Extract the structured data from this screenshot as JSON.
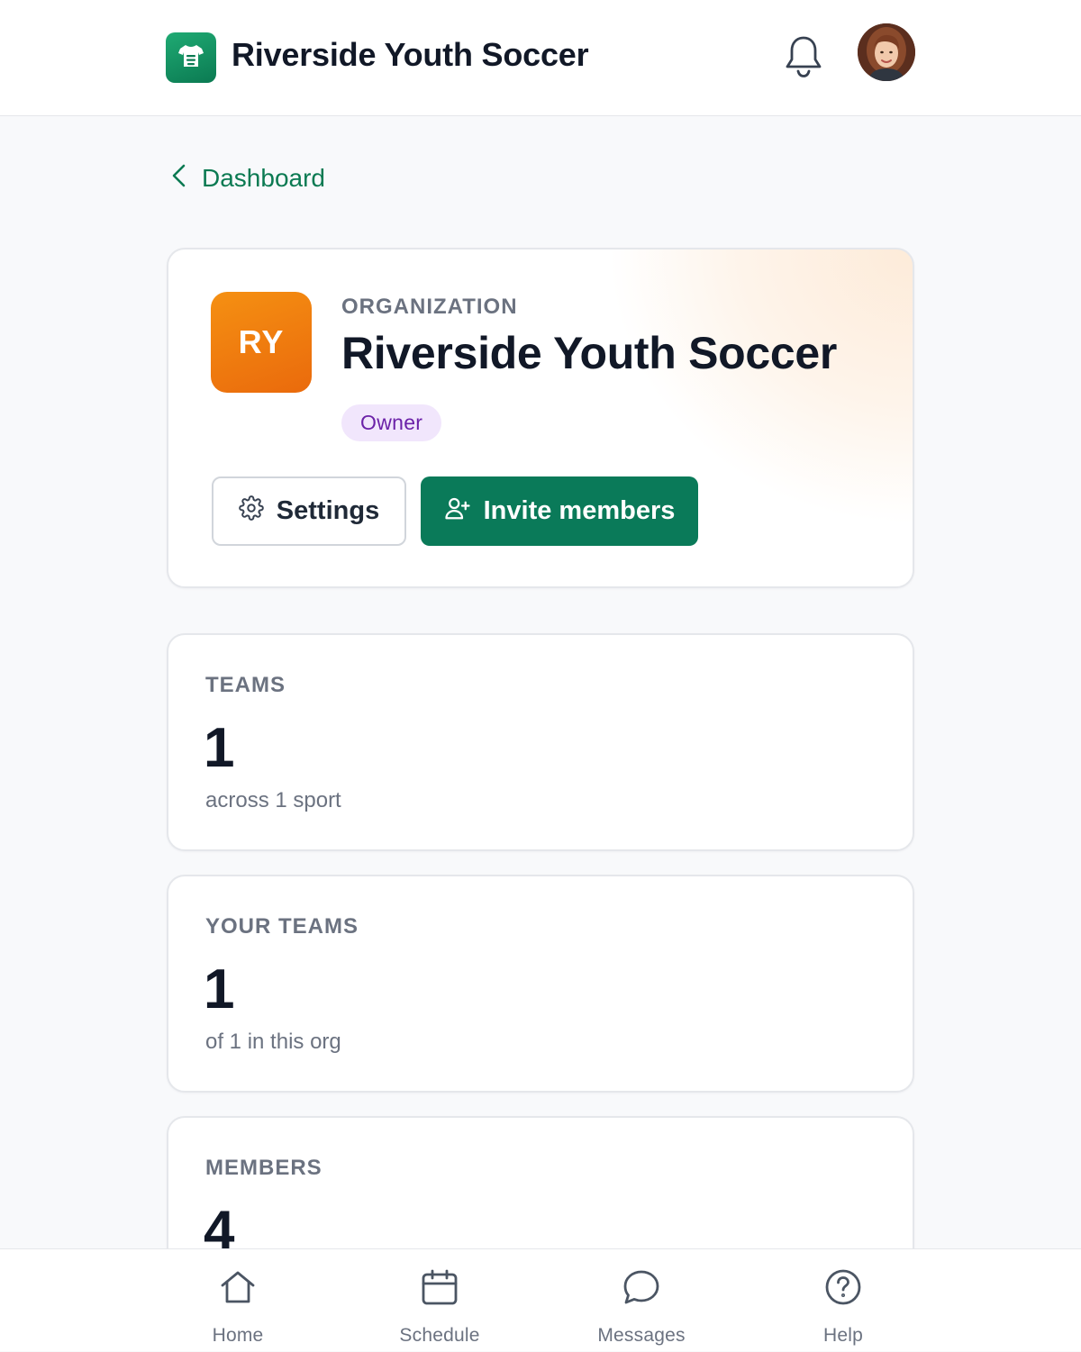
{
  "header": {
    "app_title": "Riverside Youth Soccer",
    "logo_icon": "jersey-icon",
    "notifications_icon": "bell-icon",
    "avatar_icon": "user-avatar",
    "brand_color": "#0b7a52"
  },
  "breadcrumb": {
    "back_label": "Dashboard",
    "icon": "chevron-left-icon"
  },
  "org_card": {
    "initials": "RY",
    "eyebrow": "ORGANIZATION",
    "name": "Riverside Youth Soccer",
    "role": "Owner",
    "settings_label": "Settings",
    "settings_icon": "gear-icon",
    "invite_label": "Invite members",
    "invite_icon": "user-plus-icon",
    "badge_color": "#ef7a0e",
    "accent_color": "#0a7a59"
  },
  "stats": [
    {
      "label": "TEAMS",
      "value": "1",
      "sub": "across 1 sport"
    },
    {
      "label": "YOUR TEAMS",
      "value": "1",
      "sub": "of 1 in this org"
    },
    {
      "label": "MEMBERS",
      "value": "4",
      "sub": ""
    }
  ],
  "bottom_nav": [
    {
      "label": "Home",
      "icon": "home-icon"
    },
    {
      "label": "Schedule",
      "icon": "calendar-icon"
    },
    {
      "label": "Messages",
      "icon": "message-icon"
    },
    {
      "label": "Help",
      "icon": "help-icon"
    }
  ]
}
